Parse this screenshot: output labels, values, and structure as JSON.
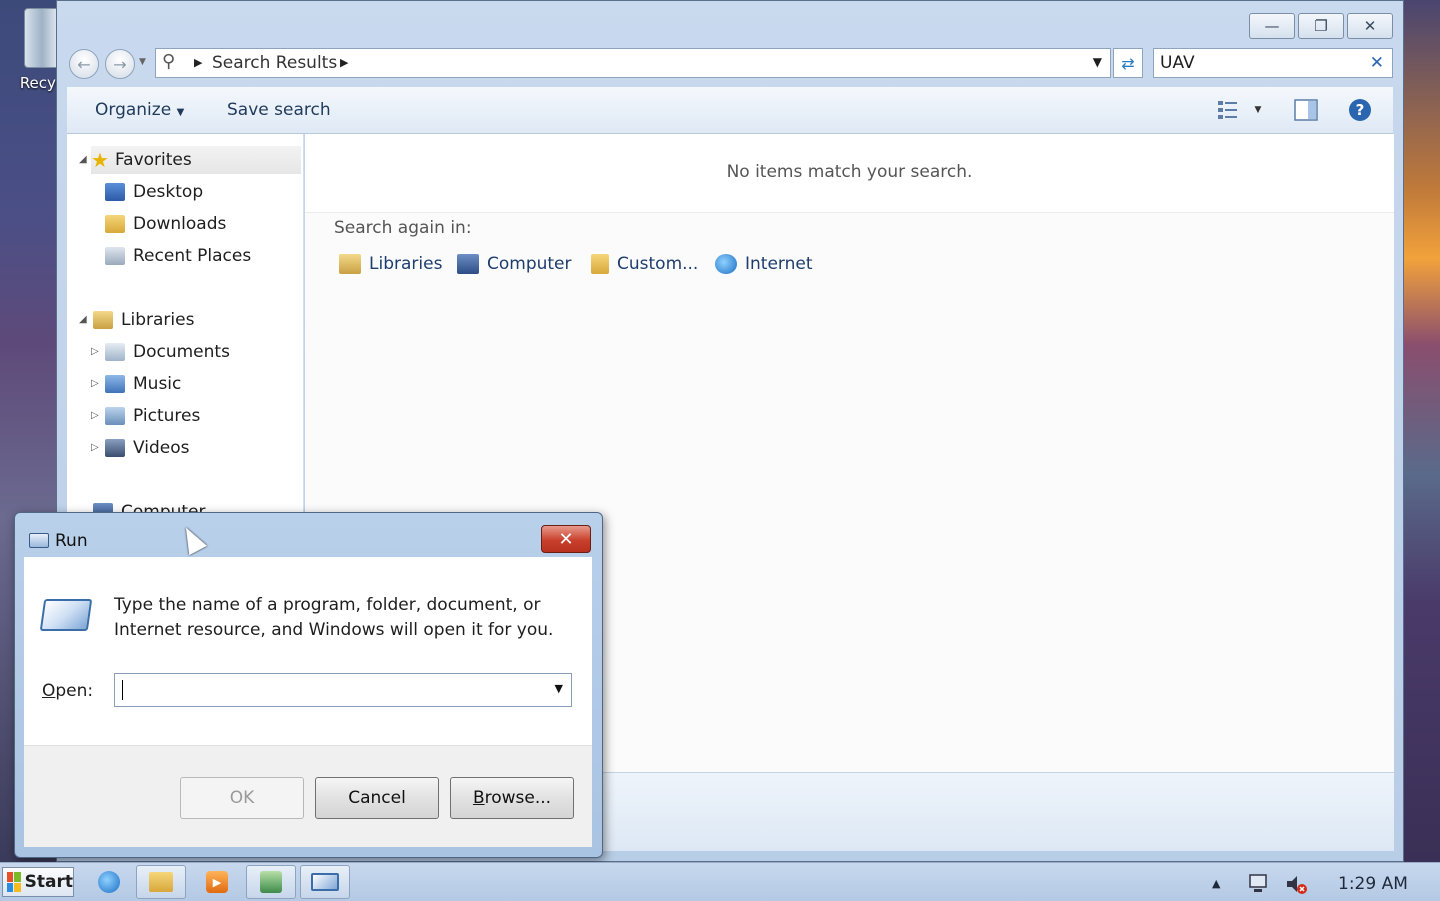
{
  "desktop": {
    "recycle_label": "Recyc"
  },
  "explorer": {
    "address": {
      "crumb": "Search Results"
    },
    "search": {
      "value": "UAV"
    },
    "toolbar": {
      "organize": "Organize",
      "save_search": "Save search"
    },
    "nav": {
      "favorites": "Favorites",
      "desktop": "Desktop",
      "downloads": "Downloads",
      "recent": "Recent Places",
      "libraries": "Libraries",
      "documents": "Documents",
      "music": "Music",
      "pictures": "Pictures",
      "videos": "Videos",
      "computer": "Computer"
    },
    "content": {
      "no_items": "No items match your search.",
      "search_again": "Search again in:",
      "links": [
        "Libraries",
        "Computer",
        "Custom...",
        "Internet"
      ]
    }
  },
  "run": {
    "title": "Run",
    "description": "Type the name of a program, folder, document, or Internet resource, and Windows will open it for you.",
    "open_label_pre": "",
    "open_label_key": "O",
    "open_label_post": "pen:",
    "open_value": "",
    "ok": "OK",
    "cancel": "Cancel",
    "browse_key": "B",
    "browse_rest": "rowse..."
  },
  "taskbar": {
    "start": "Start",
    "clock": "1:29 AM"
  },
  "colors": {
    "accent": "#2a66b0",
    "close_red": "#c9402c"
  }
}
